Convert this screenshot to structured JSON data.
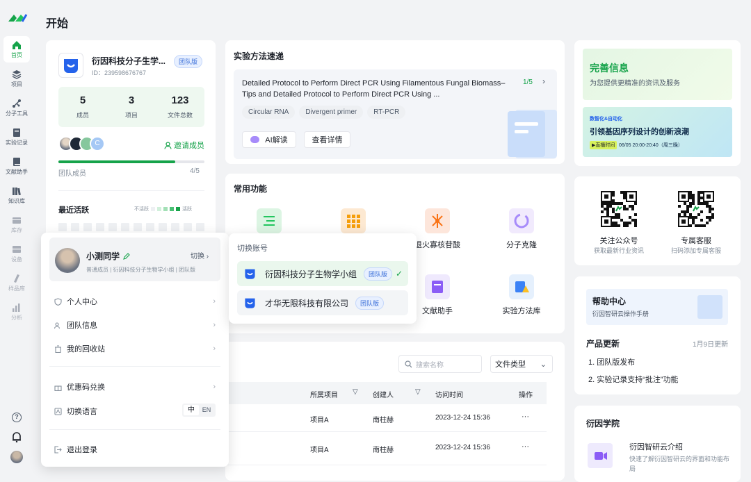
{
  "page_title": "开始",
  "sidebar": {
    "items": [
      {
        "label": "首页",
        "icon": "home-icon"
      },
      {
        "label": "项目",
        "icon": "layers-icon"
      },
      {
        "label": "分子工具",
        "icon": "molecule-icon"
      },
      {
        "label": "实验记录",
        "icon": "notebook-icon"
      },
      {
        "label": "文献助手",
        "icon": "book-icon"
      },
      {
        "label": "知识库",
        "icon": "library-icon"
      },
      {
        "label": "库存",
        "icon": "inventory-icon"
      },
      {
        "label": "设备",
        "icon": "device-icon"
      },
      {
        "label": "样品库",
        "icon": "sample-icon"
      },
      {
        "label": "分析",
        "icon": "analysis-icon"
      }
    ]
  },
  "team": {
    "name": "衍因科技分子生学...",
    "id": "ID：239598676767",
    "tag": "团队版",
    "stats": [
      {
        "value": "5",
        "label": "成员"
      },
      {
        "value": "3",
        "label": "项目"
      },
      {
        "value": "123",
        "label": "文件总数"
      }
    ],
    "avatar_c": "C",
    "invite": "邀请成员",
    "members_label": "团队成员",
    "members_count": "4/5",
    "members_progress": 0.8,
    "activity_title": "最近活跃",
    "activity_low": "不活跃",
    "activity_high": "活跃"
  },
  "protocol": {
    "section_title": "实验方法速递",
    "title": "Detailed Protocol to Perform Direct PCR Using Filamentous Fungal Biomass–Tips and Detailed Protocol to Perform Direct PCR Using ...",
    "pager": "1/5",
    "tags": [
      "Circular RNA",
      "Divergent primer",
      "RT-PCR"
    ],
    "ai_button": "AI解读",
    "detail_button": "查看详情"
  },
  "functions": {
    "title": "常用功能",
    "items": [
      "退火寡核苷酸",
      "分子克隆",
      "文献助手",
      "实验方法库"
    ]
  },
  "files": {
    "search_placeholder": "搜索名称",
    "type_filter": "文件类型",
    "columns": [
      "所属项目",
      "创建人",
      "访问时间",
      "操作"
    ],
    "rows": [
      {
        "project": "项目A",
        "creator": "南柱赫",
        "time": "2023-12-24 15:36",
        "op": "···"
      },
      {
        "project": "项目A",
        "creator": "南柱赫",
        "time": "2023-12-24 15:36",
        "op": "···"
      }
    ]
  },
  "promo": {
    "title": "完善信息",
    "subtitle": "为您提供更精准的资讯及服务",
    "banner_kicker": "数智化&自动化",
    "banner_title": "引领基因序列设计的创新浪潮",
    "banner_badge": "▶直播时间",
    "banner_time": "06/05  20:00-20:40（周三晚）"
  },
  "qr": [
    {
      "title": "关注公众号",
      "desc": "获取最新行业资讯"
    },
    {
      "title": "专属客服",
      "desc": "扫码添加专属客服"
    }
  ],
  "help": {
    "title": "帮助中心",
    "desc": "衍因智研云操作手册",
    "updates_title": "产品更新",
    "updates_date": "1月9日更新",
    "updates": [
      "1. 团队版发布",
      "2. 实验记录支持“批注”功能"
    ]
  },
  "academy": {
    "title": "衍因学院",
    "item_title": "衍因智研云介绍",
    "item_desc": "快速了解衍因智研云的界面和功能布局"
  },
  "user_menu": {
    "name": "小测同学",
    "role": "普通成员 | 衍因科技分子生物学小组 | 团队版",
    "switch": "切换",
    "items": [
      "个人中心",
      "团队信息",
      "我的回收站",
      "优惠码兑换",
      "切换语言",
      "退出登录"
    ],
    "lang_zh": "中",
    "lang_en": "EN"
  },
  "account_switch": {
    "title": "切换账号",
    "accounts": [
      {
        "name": "衍因科技分子生物学小组",
        "tag": "团队版"
      },
      {
        "name": "才华无限科技有限公司",
        "tag": "团队版"
      }
    ]
  },
  "colors": {
    "accent": "#16a34a",
    "blue": "#3b6fd9"
  }
}
